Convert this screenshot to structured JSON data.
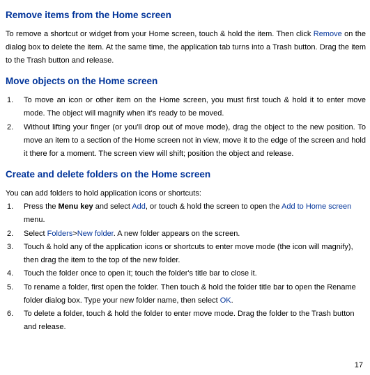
{
  "section1": {
    "heading": "Remove items from the Home screen",
    "p1a": "To remove a shortcut or widget from your Home screen, touch & hold the item. Then click ",
    "p1b": "Remove",
    "p1c": " on the dialog box to delete the item. At the same time, the application tab turns into a Trash button. Drag the item to the Trash button and release."
  },
  "section2": {
    "heading": "Move objects on the Home screen",
    "items": [
      "To move an icon or other item on the Home screen, you must first touch & hold it to enter move mode. The object will magnify when it's ready to be moved.",
      "Without lifting your finger (or you'll drop out of move mode), drag the object to the new position. To move an item to a section of the Home screen not in view, move it to the edge of the screen and hold it there for a moment. The screen view will shift; position the object and release."
    ]
  },
  "section3": {
    "heading": "Create and delete folders on the Home screen",
    "intro": "You can add folders to hold application icons or shortcuts:",
    "items": {
      "i1a": "Press the ",
      "i1b": "Menu key",
      "i1c": " and select ",
      "i1d": "Add",
      "i1e": ", or touch & hold the screen to open the ",
      "i1f": "Add to Home screen",
      "i1g": " menu.",
      "i2a": "Select ",
      "i2b": "Folders",
      "i2c": ">",
      "i2d": "New folder",
      "i2e": ". A new folder appears on the screen.",
      "i3": "Touch & hold any of the application icons or shortcuts to enter move mode (the icon will magnify), then drag the item to the top of the new folder.",
      "i4": "Touch the folder once to open it; touch the folder's title bar to close it.",
      "i5a": "To rename a folder, first open the folder. Then touch & hold the folder title bar to open the Rename folder dialog box. Type your new folder name, then select ",
      "i5b": "OK",
      "i5c": ".",
      "i6": "To delete a folder, touch & hold the folder to enter move mode. Drag the folder to the Trash button and release."
    }
  },
  "pageNumber": "17"
}
